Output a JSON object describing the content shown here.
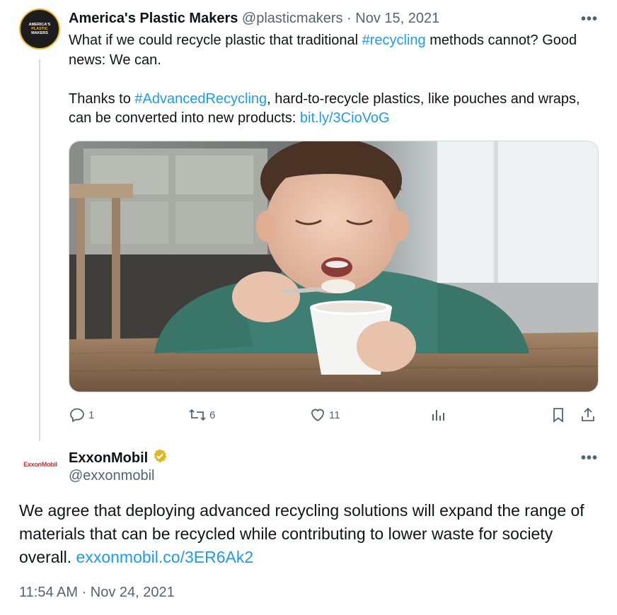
{
  "tweet1": {
    "avatar_line1": "AMERICA'S",
    "avatar_line2": "PLASTIC",
    "avatar_line3": "MAKERS",
    "author_name": "America's Plastic Makers",
    "handle": "@plasticmakers",
    "separator": " · ",
    "date": "Nov 15, 2021",
    "more_label": "•••",
    "para1_a": "What if we could recycle plastic that traditional ",
    "para1_hashtag": "#recycling",
    "para1_b": " methods cannot? Good news: We can.",
    "para2_a": "Thanks to ",
    "para2_hashtag": "#AdvancedRecycling",
    "para2_b": ", hard-to-recycle plastics, like pouches and wraps, can be converted into new products: ",
    "para2_link": "bit.ly/3CioVoG",
    "actions": {
      "replies": "1",
      "retweets": "6",
      "likes": "11"
    }
  },
  "tweet2": {
    "avatar_text": "ExxonMobil",
    "author_name": "ExxonMobil",
    "handle": "@exxonmobil",
    "more_label": "•••",
    "body": "We agree that deploying advanced recycling solutions will expand the range of materials that can be recycled while contributing to lower waste for society overall. ",
    "link": "exxonmobil.co/3ER6Ak2",
    "timestamp": "11:54 AM · Nov 24, 2021"
  },
  "colors": {
    "link": "#1d9bf0",
    "muted": "#536471",
    "verified": "#e2b719",
    "exxon_red": "#e02a2a"
  },
  "icons": [
    "reply-icon",
    "retweet-icon",
    "like-icon",
    "views-icon",
    "bookmark-icon",
    "share-icon",
    "verified-badge-icon",
    "more-icon"
  ]
}
